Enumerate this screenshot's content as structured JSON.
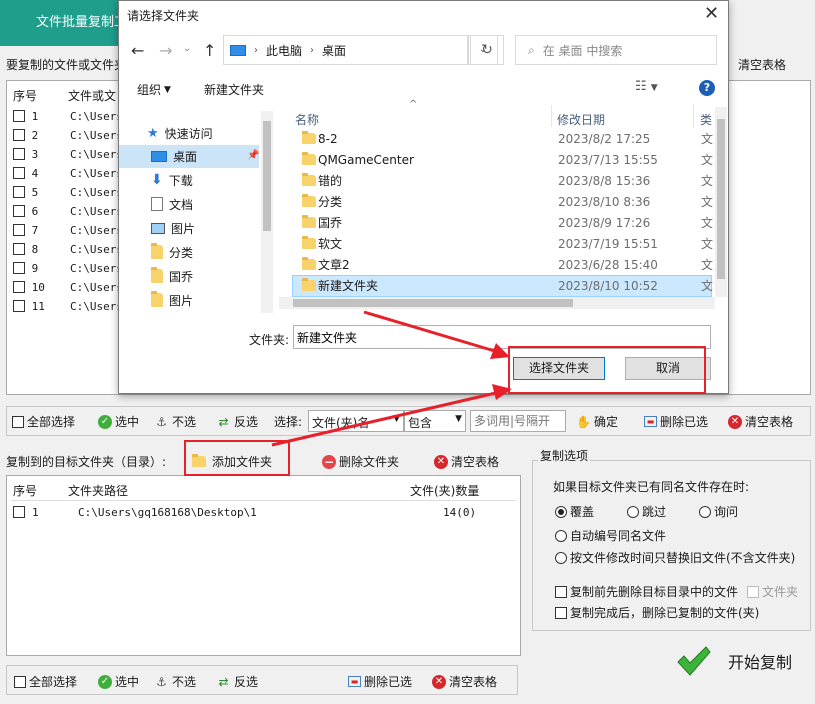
{
  "app": {
    "title": "文件批量复制工具",
    "source_label": "要复制的文件或文件夹",
    "clear_table_top": "清空表格",
    "source_table": {
      "col_no": "序号",
      "col_path": "文件或文",
      "rows": [
        {
          "no": "1",
          "path": "C:\\Users"
        },
        {
          "no": "2",
          "path": "C:\\Users"
        },
        {
          "no": "3",
          "path": "C:\\Users"
        },
        {
          "no": "4",
          "path": "C:\\Users"
        },
        {
          "no": "5",
          "path": "C:\\Users"
        },
        {
          "no": "6",
          "path": "C:\\Users"
        },
        {
          "no": "7",
          "path": "C:\\Users"
        },
        {
          "no": "8",
          "path": "C:\\Users"
        },
        {
          "no": "9",
          "path": "C:\\Users"
        },
        {
          "no": "10",
          "path": "C:\\Users"
        },
        {
          "no": "11",
          "path": "C:\\Users"
        }
      ]
    },
    "toolbar1": {
      "select_all": "全部选择",
      "check": "选中",
      "uncheck": "不选",
      "invert": "反选",
      "select_label": "选择:",
      "select_type": "文件(夹)名",
      "contains": "包含",
      "keyword_placeholder": "多词用|号隔开",
      "confirm": "确定",
      "delete_selected": "删除已选",
      "clear_table": "清空表格"
    },
    "target": {
      "label": "复制到的目标文件夹（目录）:",
      "add_folder": "添加文件夹",
      "delete_folder": "删除文件夹",
      "clear_table": "清空表格",
      "col_no": "序号",
      "col_path": "文件夹路径",
      "col_count": "文件(夹)数量",
      "rows": [
        {
          "no": "1",
          "path": "C:\\Users\\gq168168\\Desktop\\1",
          "count": "14(0)"
        }
      ]
    },
    "options": {
      "title": "复制选项",
      "same_name_label": "如果目标文件夹已有同名文件存在时:",
      "overwrite": "覆盖",
      "skip": "跳过",
      "ask": "询问",
      "auto_rename": "自动编号同名文件",
      "replace_by_time": "按文件修改时间只替换旧文件(不含文件夹)",
      "delete_before": "复制前先删除目标目录中的文件",
      "folders": "文件夹",
      "delete_after": "复制完成后，删除已复制的文件(夹)"
    },
    "toolbar2": {
      "select_all": "全部选择",
      "check": "选中",
      "uncheck": "不选",
      "invert": "反选",
      "delete_selected": "删除已选",
      "clear_table": "清空表格"
    },
    "start_copy": "开始复制"
  },
  "dialog": {
    "title": "请选择文件夹",
    "address": {
      "this_pc": "此电脑",
      "desktop": "桌面"
    },
    "search_placeholder": "在 桌面 中搜索",
    "organize": "组织",
    "new_folder": "新建文件夹",
    "nav": {
      "quick_access": "快速访问",
      "items": [
        "桌面",
        "下载",
        "文档",
        "图片",
        "分类",
        "国乔",
        "图片"
      ]
    },
    "columns": {
      "name": "名称",
      "date": "修改日期",
      "type": "类"
    },
    "files": [
      {
        "name": "8-2",
        "date": "2023/8/2 17:25",
        "type": "文"
      },
      {
        "name": "QMGameCenter",
        "date": "2023/7/13 15:55",
        "type": "文"
      },
      {
        "name": "错的",
        "date": "2023/8/8 15:36",
        "type": "文"
      },
      {
        "name": "分类",
        "date": "2023/8/10 8:36",
        "type": "文"
      },
      {
        "name": "国乔",
        "date": "2023/8/9 17:26",
        "type": "文"
      },
      {
        "name": "软文",
        "date": "2023/7/19 15:51",
        "type": "文"
      },
      {
        "name": "文章2",
        "date": "2023/6/28 15:40",
        "type": "文"
      },
      {
        "name": "新建文件夹",
        "date": "2023/8/10 10:52",
        "type": "文"
      }
    ],
    "folder_label": "文件夹:",
    "folder_value": "新建文件夹",
    "select_button": "选择文件夹",
    "cancel_button": "取消"
  }
}
